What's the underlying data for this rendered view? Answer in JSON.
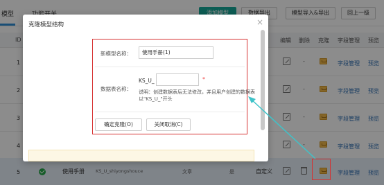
{
  "top": {
    "tab_model": "模型",
    "tab_func": "功能开关",
    "btn_add": "添加模型",
    "btn_import": "数据导出",
    "btn_import_export": "模型导入&导出",
    "btn_back": "回上一级"
  },
  "table": {
    "headers": {
      "id": "ID",
      "edit": "编辑",
      "delete": "删除",
      "clone": "克隆",
      "fields": "字段管理",
      "preview": "预览"
    },
    "rows": [
      {
        "id": "1",
        "fields": "字段管理",
        "preview": "预览"
      },
      {
        "id": "2",
        "fields": "字段管理",
        "preview": "预览"
      },
      {
        "id": "3",
        "fields": "字段管理",
        "preview": "预览"
      },
      {
        "id": "4",
        "fields": "字段管理",
        "preview": "预览"
      }
    ],
    "last_row": {
      "id": "5",
      "name": "使用手册",
      "table": "KS_U_shiyongshouce",
      "col4": "文章",
      "col5": "是",
      "type": "自定义",
      "fields": "字段管理",
      "preview": "预览"
    },
    "dash": "-"
  },
  "dialog": {
    "title": "克隆模型结构",
    "close": "×",
    "new_name_label": "新模型名称：",
    "new_name_value": "使用手册(1)",
    "table_label": "数据表名称：",
    "table_prefix": "KS_U_",
    "table_value": "",
    "required_mark": "*",
    "help_text": "说明：创建数据表后无法修改，并且用户创建的数据表以\"KS_U_\"开头",
    "confirm_button": "确定克隆(O)",
    "cancel_button": "关闭取消(C)"
  },
  "colors": {
    "accent": "#18a99a",
    "highlight": "#d63030",
    "arrow": "#3fc3c9"
  }
}
